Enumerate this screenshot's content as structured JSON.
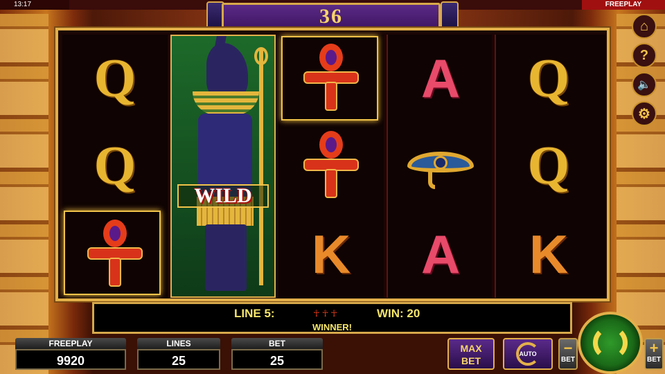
{
  "status": {
    "time": "13:17",
    "mode": "FREEPLAY"
  },
  "header": {
    "counter": "36"
  },
  "reels": [
    [
      "Q",
      "Q",
      "ankh"
    ],
    [
      "wild"
    ],
    [
      "ankh",
      "ankh",
      "K"
    ],
    [
      "A",
      "eye",
      "A"
    ],
    [
      "Q",
      "Q",
      "K"
    ]
  ],
  "wild": {
    "label": "WILD"
  },
  "message": {
    "line": "LINE 5:",
    "win": "WIN: 20",
    "status": "WINNER!"
  },
  "stats": {
    "freeplay": {
      "label": "FREEPLAY",
      "value": "9920"
    },
    "lines": {
      "label": "LINES",
      "value": "25"
    },
    "bet": {
      "label": "BET",
      "value": "25"
    }
  },
  "controls": {
    "max_bet_line1": "MAX",
    "max_bet_line2": "BET",
    "auto_label": "AUTO",
    "bet_minus": "−",
    "bet_plus": "+",
    "bet_caption": "BET"
  },
  "side_icons": [
    "home-icon",
    "help-icon",
    "mute-icon",
    "settings-icon"
  ],
  "side_glyphs": {
    "home": "⌂",
    "help": "?",
    "mute": "🔈",
    "settings": "⚙"
  },
  "colors": {
    "accent_gold": "#e3b04a",
    "plaque_purple": "#5b2a86",
    "spin_green": "#2f9a2a",
    "message_text": "#f5e56a"
  }
}
